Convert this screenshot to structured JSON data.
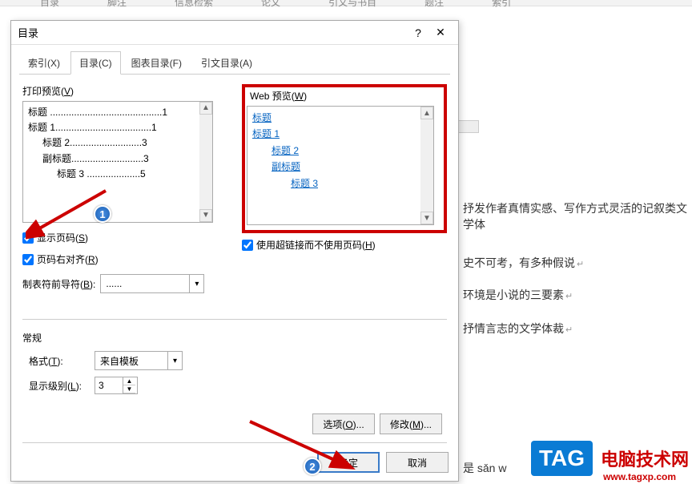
{
  "ribbon": {
    "items": [
      "目录",
      "脚注",
      "信息检索",
      "论文",
      "引文与书目",
      "题注",
      "索引"
    ]
  },
  "dialog": {
    "title": "目录",
    "help_label": "?",
    "close_label": "✕",
    "tabs": {
      "index": "索引(X)",
      "toc": "目录(C)",
      "figures": "图表目录(F)",
      "citations": "引文目录(A)"
    },
    "print_preview_label": "打印预览(V)",
    "web_preview_label": "Web 预览(W)",
    "print_lines": [
      {
        "text": "标题",
        "dots": "..........................................",
        "page": "1",
        "indent": 0
      },
      {
        "text": "标题  1",
        "dots": "....................................",
        "page": "1",
        "indent": 0
      },
      {
        "text": "标题  2",
        "dots": "...........................",
        "page": "3",
        "indent": 1
      },
      {
        "text": "副标题",
        "dots": "...........................",
        "page": "3",
        "indent": 1
      },
      {
        "text": "标题  3",
        "dots": "....................",
        "page": "5",
        "indent": 2
      }
    ],
    "web_lines": [
      {
        "text": "标题",
        "indent": 0
      },
      {
        "text": "标题  1",
        "indent": 0
      },
      {
        "text": "标题  2",
        "indent": 1
      },
      {
        "text": "副标题",
        "indent": 1
      },
      {
        "text": "标题  3",
        "indent": 2
      }
    ],
    "show_page": "显示页码(S)",
    "right_align": "页码右对齐(R)",
    "leader_label": "制表符前导符(B):",
    "leader_value": "......",
    "use_hyperlinks": "使用超链接而不使用页码(H)",
    "general_label": "常规",
    "format_label": "格式(T):",
    "format_value": "来自模板",
    "levels_label": "显示级别(L):",
    "levels_value": "3",
    "options_btn": "选项(O)...",
    "modify_btn": "修改(M)...",
    "ok_btn": "确定",
    "cancel_btn": "取消"
  },
  "bg": {
    "t1": "抒发作者真情实感、写作方式灵活的记叙类文学体",
    "t2": "史不可考，有多种假说",
    "t3": "环境是小说的三要素",
    "t4": "抒情言志的文学体裁",
    "t5": "是 sǎn w"
  },
  "watermark": {
    "tag": "TAG",
    "text": "电脑技术网",
    "url": "www.tagxp.com"
  }
}
